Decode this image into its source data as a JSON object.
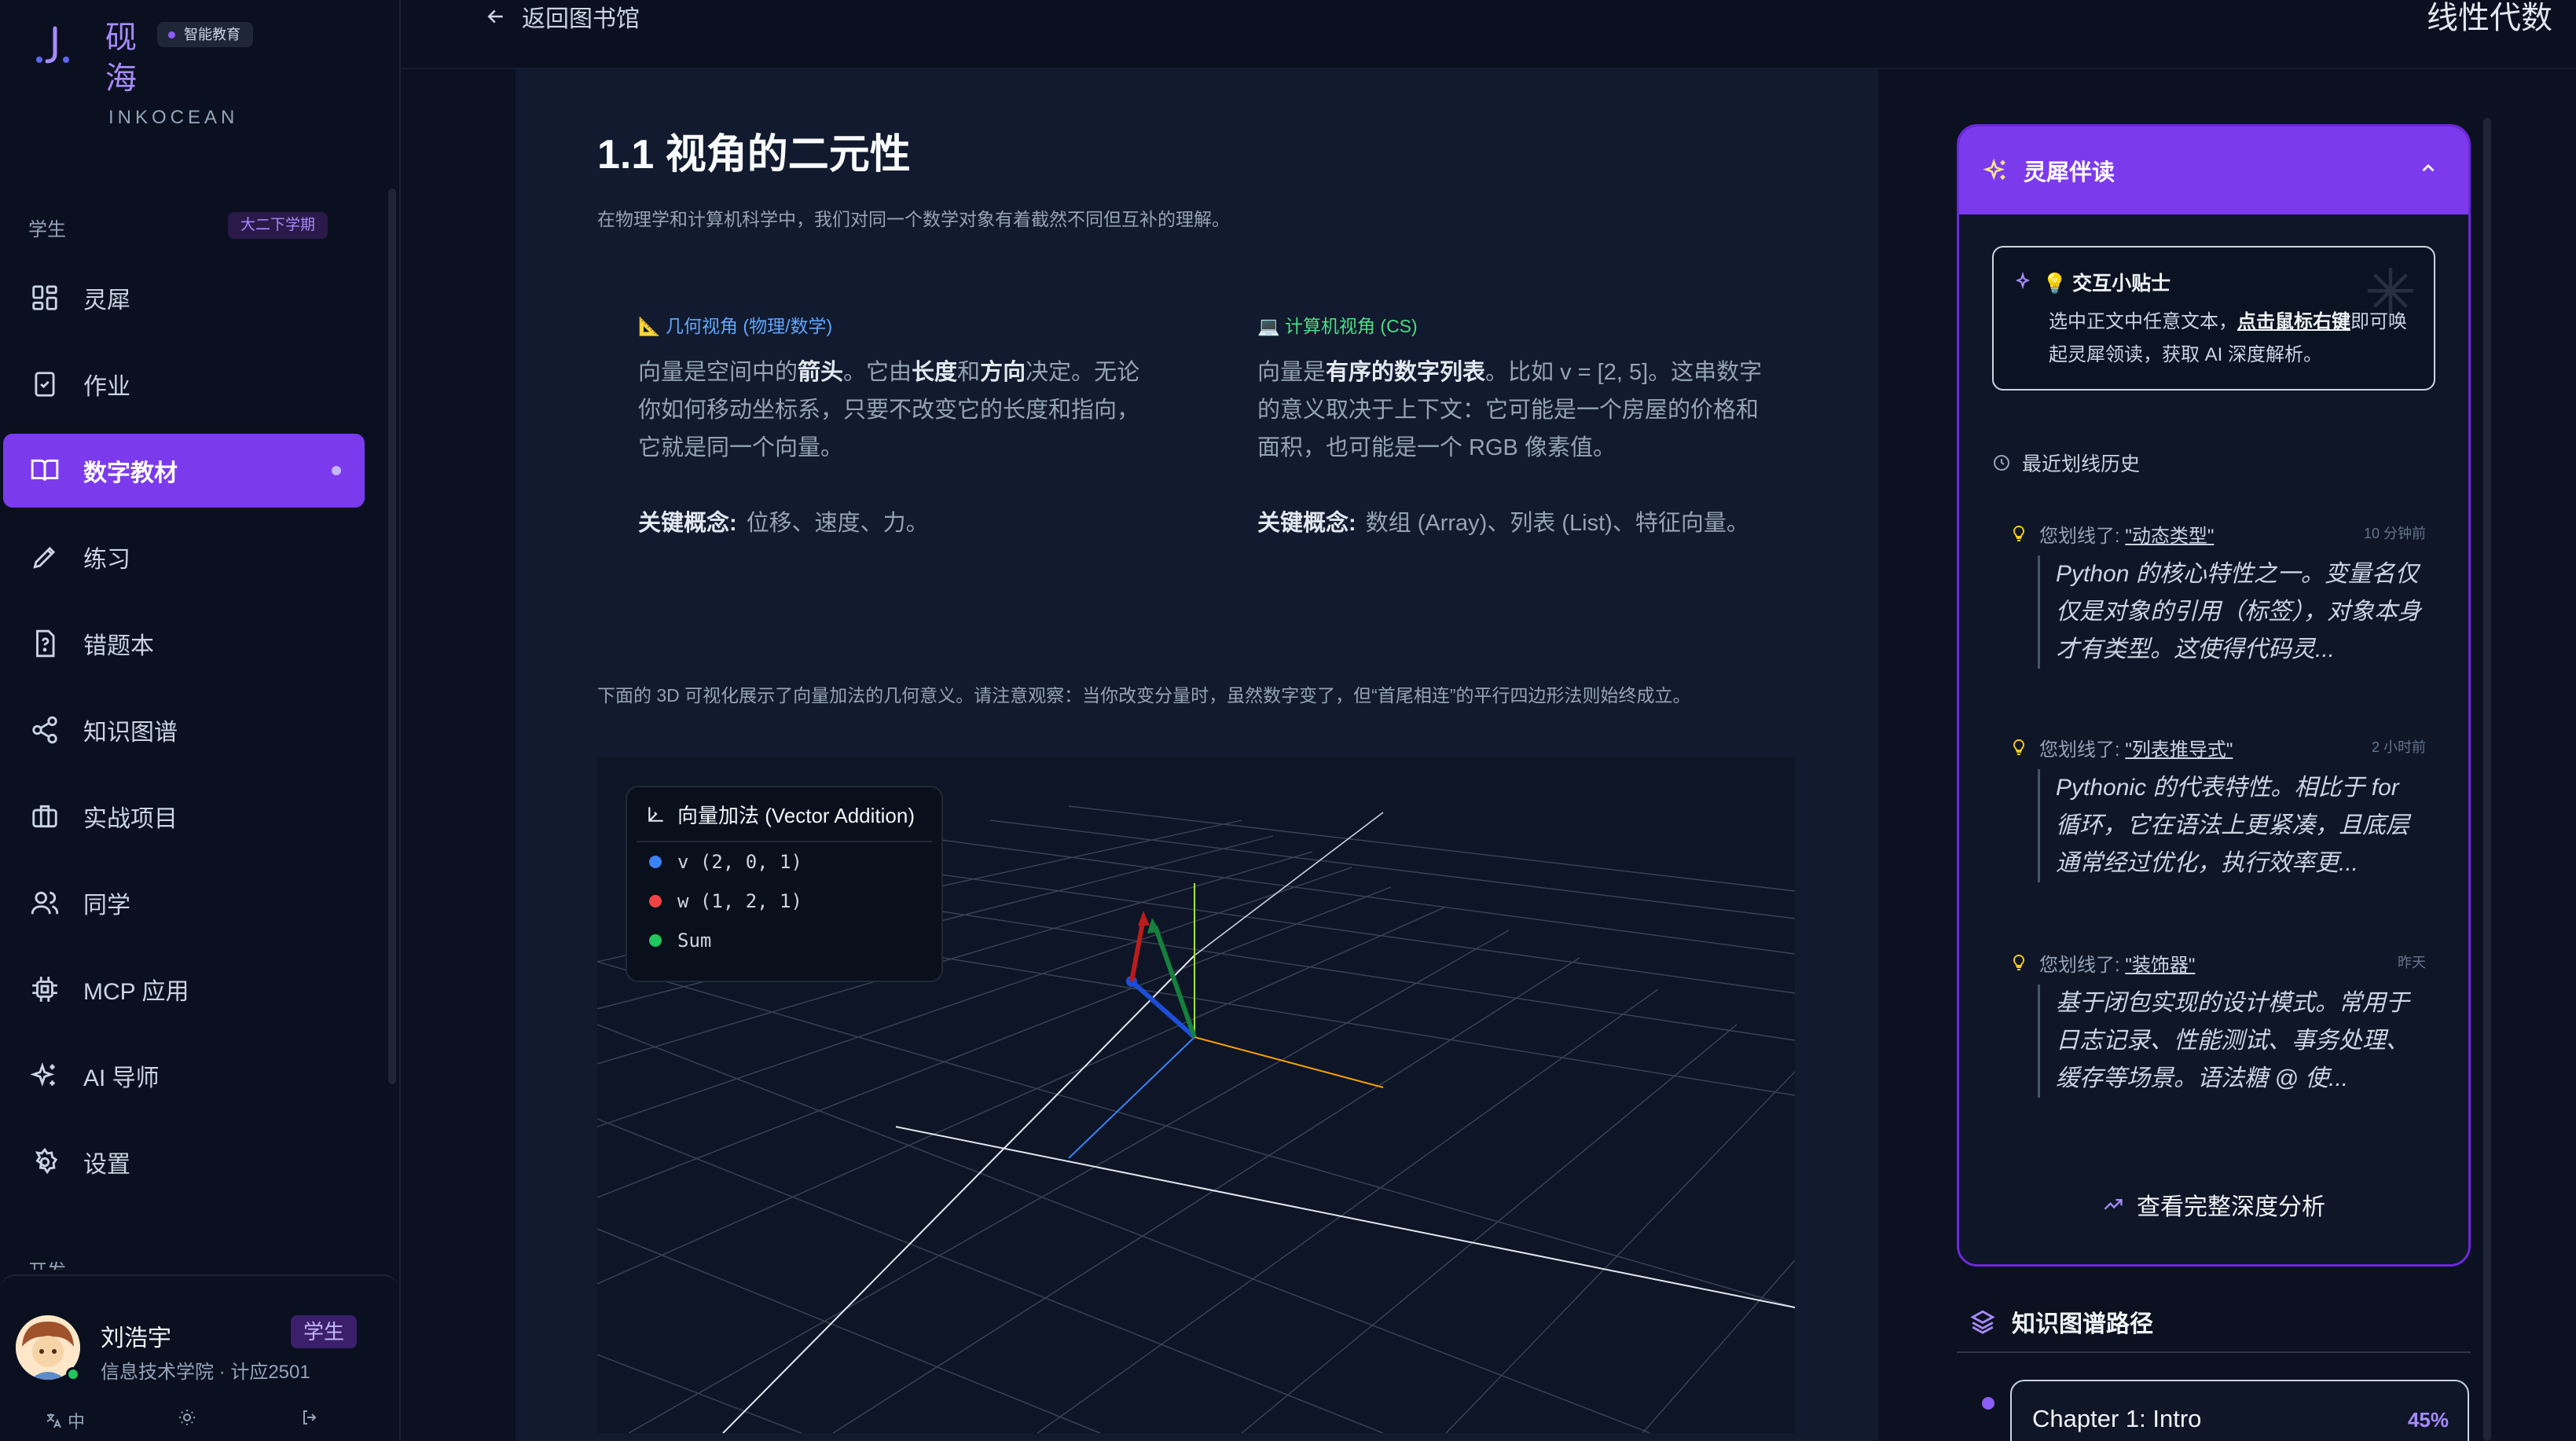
{
  "brand": {
    "name": "砚海",
    "badge": "智能教育",
    "subtitle": "INKOCEAN"
  },
  "sidebar": {
    "section_label": "学生",
    "term_badge": "大二下学期",
    "items": [
      {
        "label": "灵犀",
        "icon": "dashboard-icon"
      },
      {
        "label": "作业",
        "icon": "clipboard-check-icon"
      },
      {
        "label": "数字教材",
        "icon": "book-open-icon",
        "active": true
      },
      {
        "label": "练习",
        "icon": "pen-icon"
      },
      {
        "label": "错题本",
        "icon": "question-file-icon"
      },
      {
        "label": "知识图谱",
        "icon": "share-nodes-icon"
      },
      {
        "label": "实战项目",
        "icon": "briefcase-icon"
      },
      {
        "label": "同学",
        "icon": "users-icon"
      },
      {
        "label": "MCP 应用",
        "icon": "chip-icon"
      },
      {
        "label": "AI 导师",
        "icon": "sparkles-icon"
      },
      {
        "label": "设置",
        "icon": "gear-icon"
      }
    ],
    "dev_label": "开发"
  },
  "user": {
    "name": "刘浩宇",
    "role": "学生",
    "org": "信息技术学院 · 计应2501",
    "lang_label": "中"
  },
  "topbar": {
    "back_label": "返回图书馆",
    "book_title": "线性代数"
  },
  "article": {
    "title": "1.1 视角的二元性",
    "intro": "在物理学和计算机科学中，我们对同一个数学对象有着截然不同但互补的理解。",
    "geo": {
      "heading": "📐 几何视角 (物理/数学)",
      "p1": "向量是空间中的",
      "b1": "箭头",
      "p2": "。它由",
      "b2": "长度",
      "p3": "和",
      "b3": "方向",
      "p4": "决定。无论你如何移动坐标系，只要不改变它的长度和指向，它就是同一个向量。",
      "key_label": "关键概念:",
      "key_value": "位移、速度、力。"
    },
    "cs": {
      "heading": "💻 计算机视角 (CS)",
      "p1": "向量是",
      "b1": "有序的数字列表",
      "p2": "。比如 v = [2, 5]。这串数字的意义取决于上下文：它可能是一个房屋的价格和面积，也可能是一个 RGB 像素值。",
      "key_label": "关键概念:",
      "key_value": "数组 (Array)、列表 (List)、特征向量。"
    },
    "viz_desc": "下面的 3D 可视化展示了向量加法的几何意义。请注意观察：当你改变分量时，虽然数字变了，但“首尾相连”的平行四边形法则始终成立。",
    "viz": {
      "title": "向量加法 (Vector Addition)",
      "legend": [
        {
          "label": "v (2, 0, 1)",
          "color": "#3b82f6"
        },
        {
          "label": "w (1, 2, 1)",
          "color": "#ef4444"
        },
        {
          "label": "Sum",
          "color": "#22c55e"
        }
      ]
    }
  },
  "companion": {
    "title": "灵犀伴读",
    "tip_title": "💡 交互小贴士",
    "tip_pre": "选中正文中任意文本，",
    "tip_link": "点击鼠标右键",
    "tip_post": "即可唤起灵犀领读，获取 AI 深度解析。",
    "history_label": "最近划线历史",
    "history": [
      {
        "prefix": "您划线了:",
        "term": "\"动态类型\"",
        "time": "10 分钟前",
        "quote": "Python 的核心特性之一。变量名仅仅是对象的引用（标签），对象本身才有类型。这使得代码灵..."
      },
      {
        "prefix": "您划线了:",
        "term": "\"列表推导式\"",
        "time": "2 小时前",
        "quote": "Pythonic 的代表特性。相比于 for 循环，它在语法上更紧凑，且底层通常经过优化，执行效率更..."
      },
      {
        "prefix": "您划线了:",
        "term": "\"装饰器\"",
        "time": "昨天",
        "quote": "基于闭包实现的设计模式。常用于日志记录、性能测试、事务处理、缓存等场景。语法糖 @ 使..."
      }
    ],
    "deep_link": "查看完整深度分析"
  },
  "knowledge_path": {
    "title": "知识图谱路径",
    "chapter": "Chapter 1: Intro",
    "progress": "45%"
  }
}
